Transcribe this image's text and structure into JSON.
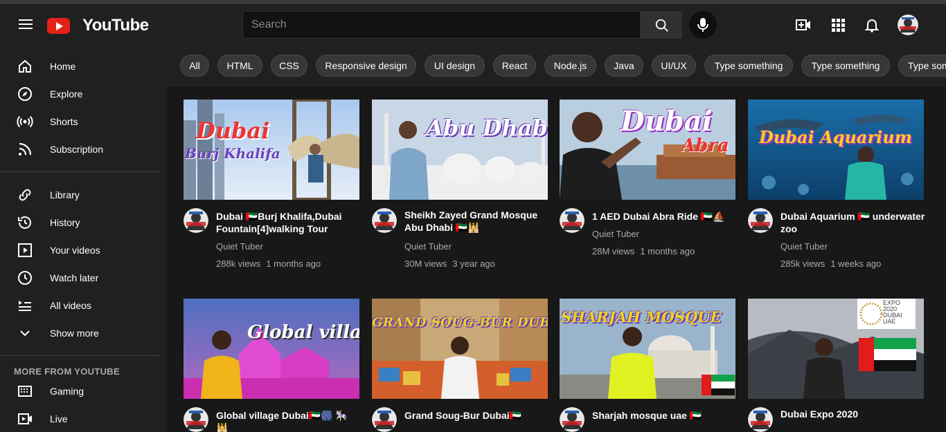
{
  "header": {
    "logo_text": "YouTube",
    "search_placeholder": "Search"
  },
  "sidebar": {
    "items": [
      {
        "label": "Home"
      },
      {
        "label": "Explore"
      },
      {
        "label": "Shorts"
      },
      {
        "label": "Subscription"
      },
      {
        "label": "Library"
      },
      {
        "label": "History"
      },
      {
        "label": "Your videos"
      },
      {
        "label": "Watch later"
      },
      {
        "label": "All videos"
      },
      {
        "label": "Show more"
      }
    ],
    "more_heading": "MORE FROM YOUTUBE",
    "more_items": [
      {
        "label": "Gaming"
      },
      {
        "label": "Live"
      }
    ]
  },
  "chips": [
    "All",
    "HTML",
    "CSS",
    "Responsive design",
    "UI design",
    "React",
    "Node.js",
    "Java",
    "UI/UX",
    "Type something",
    "Type something",
    "Type something"
  ],
  "videos": [
    {
      "thumb_text": "Dubai",
      "thumb_text2": "Burj Khalifa",
      "title": "Dubai 🇦🇪Burj Khalifa,Dubai Fountain[4]walking Tour",
      "channel": "Quiet Tuber",
      "views": "288k views",
      "age": "1 months ago"
    },
    {
      "thumb_text": "Abu Dhabi",
      "title": "Sheikh Zayed Grand Mosque Abu Dhabi 🇦🇪🕌",
      "channel": "Quiet Tuber",
      "views": "30M views",
      "age": "3 year ago"
    },
    {
      "thumb_text": "Dubai",
      "thumb_text2": "Abra",
      "title": "1 AED Dubai Abra Ride 🇦🇪⛵",
      "channel": "Quiet Tuber",
      "views": "28M views",
      "age": "1 months ago"
    },
    {
      "thumb_text": "Dubai Aquarium",
      "title": "Dubai Aquarium 🇦🇪 underwater zoo",
      "channel": "Quiet Tuber",
      "views": "285k views",
      "age": "1 weeks ago"
    },
    {
      "thumb_text": "Global village",
      "title": "Global village Dubai🇦🇪🎆 🎠 🕌",
      "channel": "Quiet Tuber",
      "views": "",
      "age": ""
    },
    {
      "thumb_text": "GRAND SOUG-BUR DUBAI",
      "title": "Grand Soug-Bur Dubai🇦🇪",
      "channel": "Quiet Tuber",
      "views": "",
      "age": ""
    },
    {
      "thumb_text": "SHARJAH MOSQUE",
      "title": "Sharjah mosque uae 🇦🇪",
      "channel": "Quiet Tuber",
      "views": "",
      "age": ""
    },
    {
      "thumb_text": "EXPO 2020 DUBAI UAE",
      "title": "Dubai Expo 2020",
      "channel": "Quiet Tuber",
      "views": "",
      "age": ""
    }
  ],
  "colors": {
    "brand_red": "#e62117",
    "bg": "#181818",
    "panel": "#202020",
    "chip": "#373737"
  }
}
